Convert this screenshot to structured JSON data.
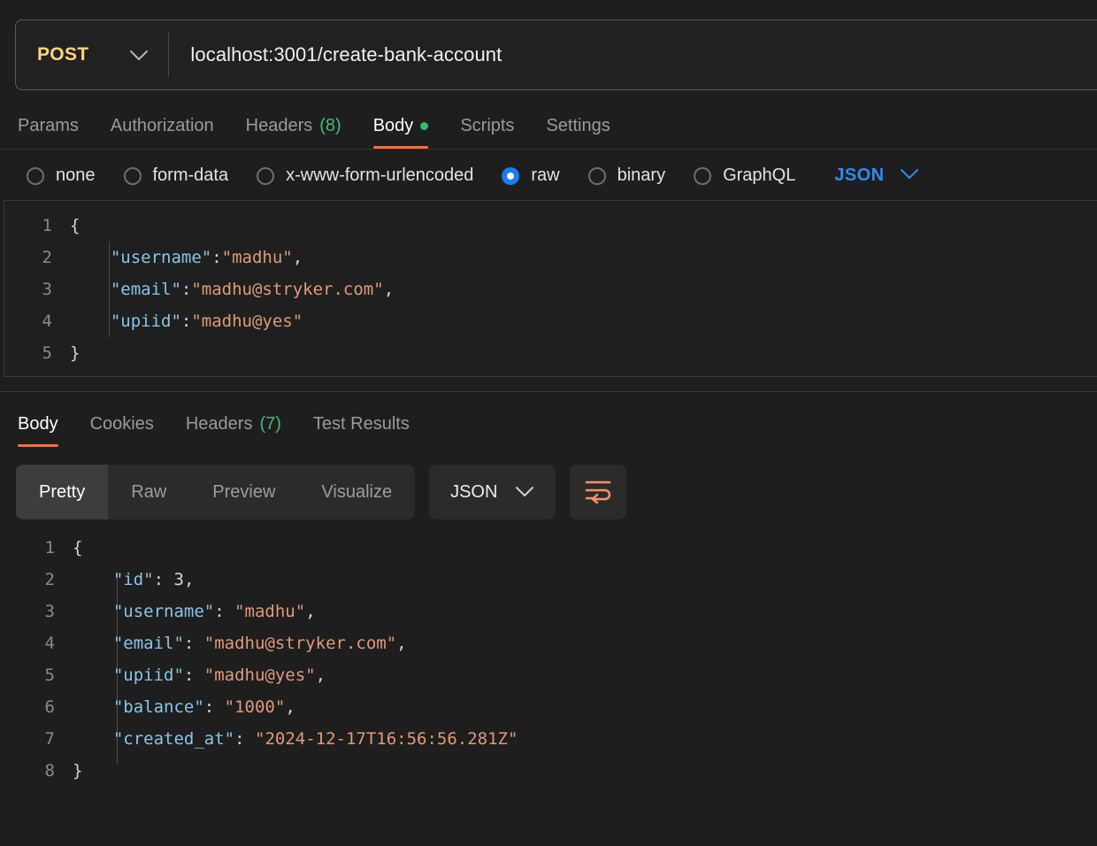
{
  "request": {
    "method": "POST",
    "method_chevron_icon": "chevron-down-icon",
    "url": "localhost:3001/create-bank-account",
    "tabs": [
      {
        "label": "Params",
        "active": false
      },
      {
        "label": "Authorization",
        "active": false
      },
      {
        "label": "Headers",
        "count": "(8)",
        "active": false
      },
      {
        "label": "Body",
        "active": true,
        "has_dot": true
      },
      {
        "label": "Scripts",
        "active": false
      },
      {
        "label": "Settings",
        "active": false
      }
    ],
    "body_types": [
      {
        "label": "none",
        "selected": false
      },
      {
        "label": "form-data",
        "selected": false
      },
      {
        "label": "x-www-form-urlencoded",
        "selected": false
      },
      {
        "label": "raw",
        "selected": true
      },
      {
        "label": "binary",
        "selected": false
      },
      {
        "label": "GraphQL",
        "selected": false
      }
    ],
    "format_select": {
      "value": "JSON",
      "chevron_icon": "chevron-down-icon"
    },
    "body_lines": [
      {
        "no": "1",
        "raw": "{"
      },
      {
        "no": "2",
        "raw": "    \"username\":\"madhu\","
      },
      {
        "no": "3",
        "raw": "    \"email\":\"madhu@stryker.com\","
      },
      {
        "no": "4",
        "raw": "    \"upiid\":\"madhu@yes\""
      },
      {
        "no": "5",
        "raw": "}"
      }
    ]
  },
  "response": {
    "tabs": [
      {
        "label": "Body",
        "active": true
      },
      {
        "label": "Cookies",
        "active": false
      },
      {
        "label": "Headers",
        "count": "(7)",
        "active": false
      },
      {
        "label": "Test Results",
        "active": false
      }
    ],
    "view_modes": [
      {
        "label": "Pretty",
        "active": true
      },
      {
        "label": "Raw",
        "active": false
      },
      {
        "label": "Preview",
        "active": false
      },
      {
        "label": "Visualize",
        "active": false
      }
    ],
    "format_select": {
      "value": "JSON",
      "chevron_icon": "chevron-down-icon"
    },
    "wrap_button_icon": "word-wrap-icon",
    "body_lines": [
      {
        "no": "1",
        "raw": "{"
      },
      {
        "no": "2",
        "raw": "    \"id\": 3,"
      },
      {
        "no": "3",
        "raw": "    \"username\": \"madhu\","
      },
      {
        "no": "4",
        "raw": "    \"email\": \"madhu@stryker.com\","
      },
      {
        "no": "5",
        "raw": "    \"upiid\": \"madhu@yes\","
      },
      {
        "no": "6",
        "raw": "    \"balance\": \"1000\","
      },
      {
        "no": "7",
        "raw": "    \"created_at\": \"2024-12-17T16:56:56.281Z\""
      },
      {
        "no": "8",
        "raw": "}"
      }
    ]
  },
  "colors": {
    "accent_orange": "#ff6c37",
    "method_post": "#ffd479",
    "link_blue": "#2f8af5",
    "radio_selected": "#1a7cf0",
    "count_green": "#4ab87b",
    "dot_green": "#2dbd6e",
    "json_key": "#89c5e8",
    "json_string": "#e09a78",
    "background": "#1e1e1e"
  }
}
